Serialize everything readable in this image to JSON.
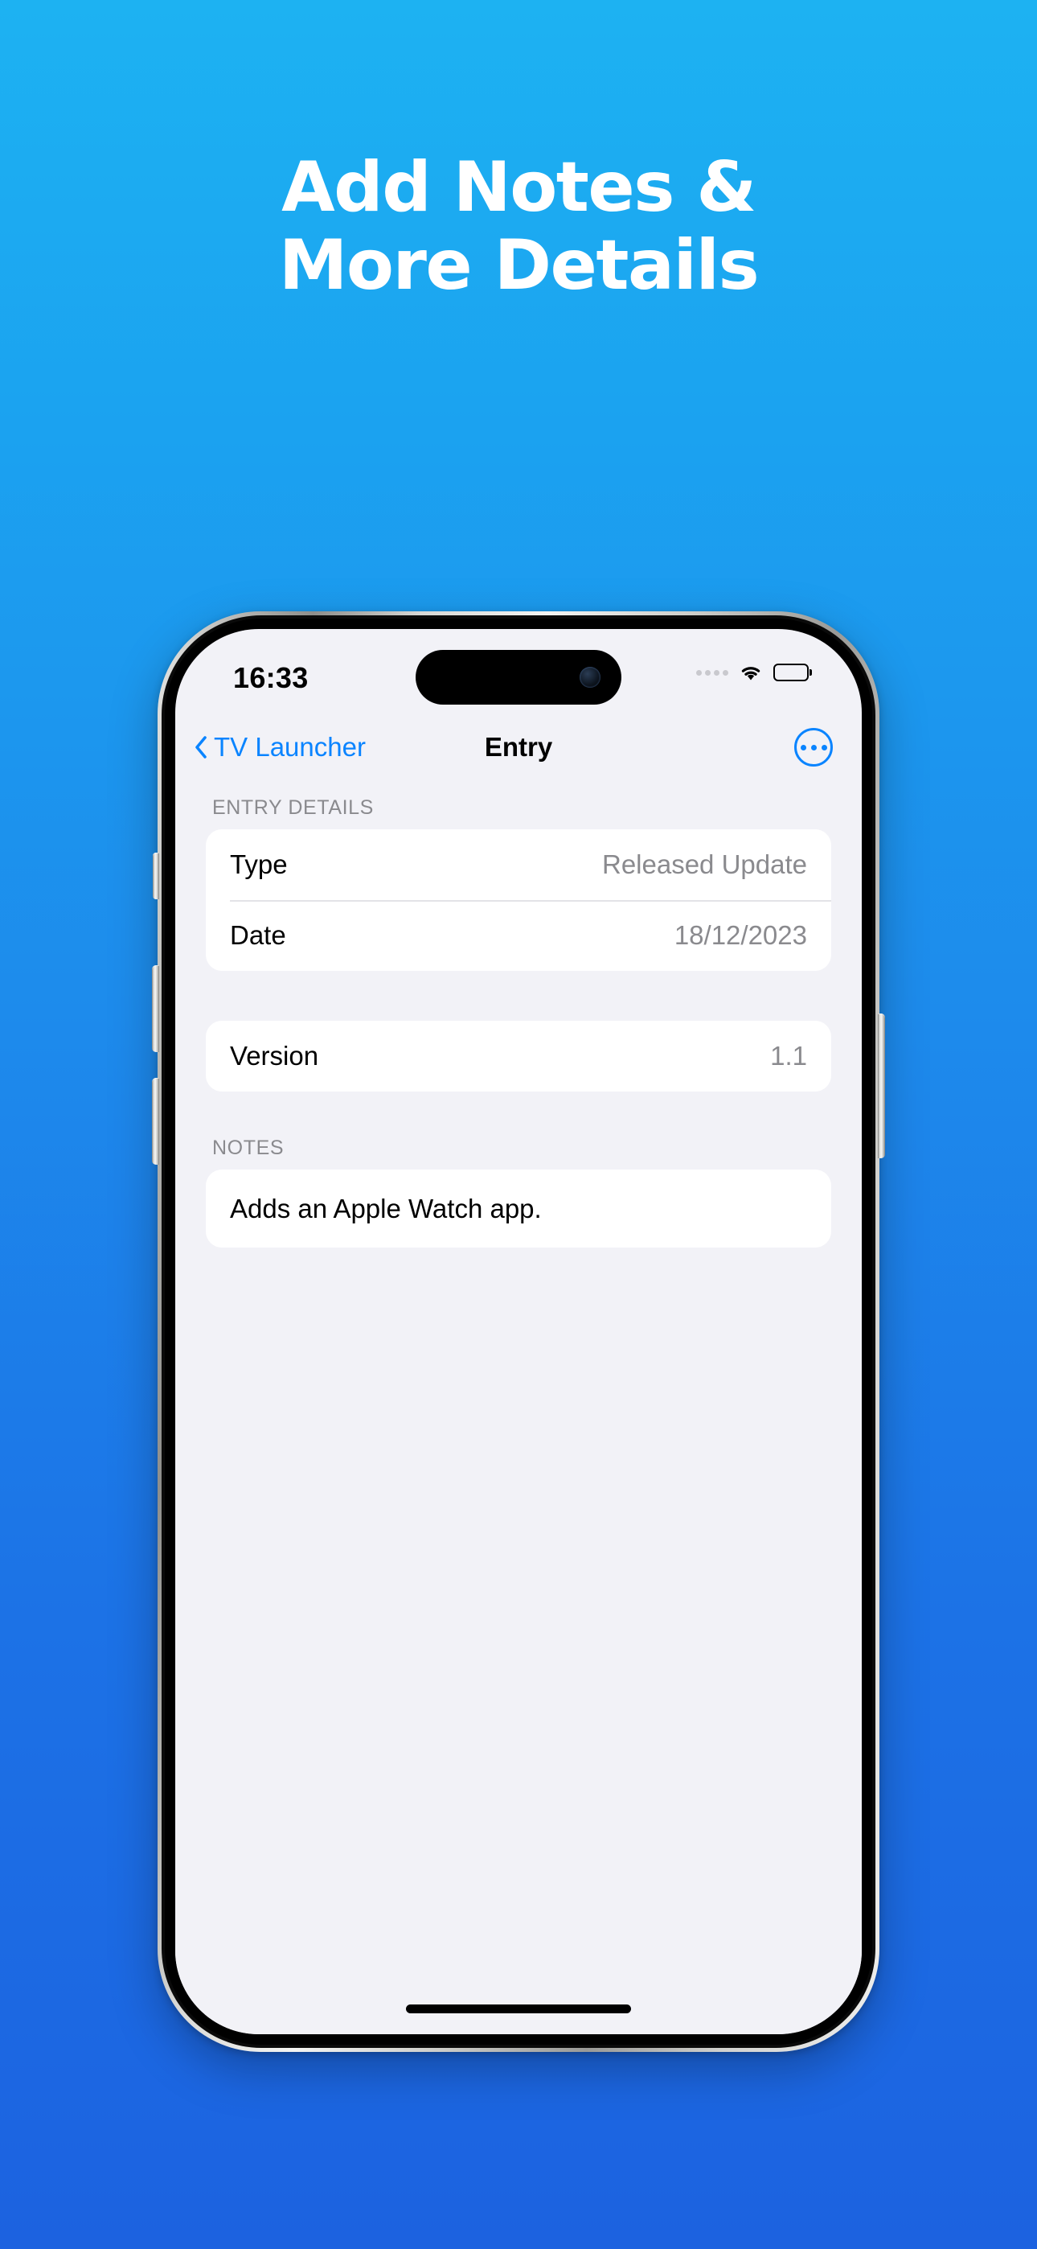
{
  "promo": {
    "headline_line1": "Add Notes &",
    "headline_line2": "More Details",
    "background_top_color": "#1DB2F2",
    "background_bottom_color": "#1C62E0"
  },
  "phone": {
    "status_bar": {
      "time": "16:33",
      "cellular_icon": "cellular-dots-icon",
      "wifi_icon": "wifi-icon",
      "battery_icon": "battery-full-icon"
    },
    "nav_bar": {
      "back_icon": "chevron-left-icon",
      "back_label": "TV Launcher",
      "title": "Entry",
      "more_icon": "ellipsis-circle-icon",
      "accent_color": "#0A84FF"
    },
    "content": {
      "entry_details_header": "ENTRY DETAILS",
      "entry_details_rows": [
        {
          "label": "Type",
          "value": "Released Update"
        },
        {
          "label": "Date",
          "value": "18/12/2023"
        }
      ],
      "version_row": {
        "label": "Version",
        "value": "1.1"
      },
      "notes_header": "NOTES",
      "notes_text": "Adds an Apple Watch app."
    },
    "home_indicator": "home-indicator"
  }
}
